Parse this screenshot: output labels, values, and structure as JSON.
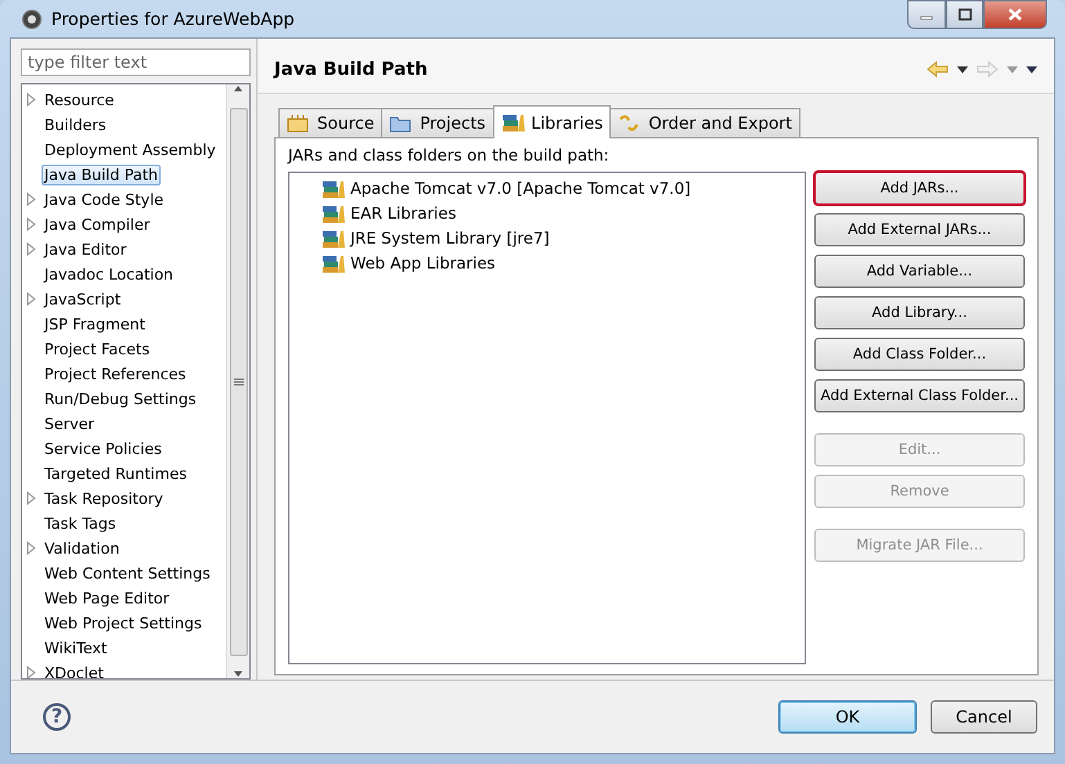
{
  "window": {
    "title": "Properties for AzureWebApp"
  },
  "filter": {
    "placeholder": "type filter text"
  },
  "tree": [
    {
      "label": "Resource",
      "expandable": true,
      "selected": false
    },
    {
      "label": "Builders",
      "expandable": false,
      "selected": false
    },
    {
      "label": "Deployment Assembly",
      "expandable": false,
      "selected": false
    },
    {
      "label": "Java Build Path",
      "expandable": false,
      "selected": true
    },
    {
      "label": "Java Code Style",
      "expandable": true,
      "selected": false
    },
    {
      "label": "Java Compiler",
      "expandable": true,
      "selected": false
    },
    {
      "label": "Java Editor",
      "expandable": true,
      "selected": false
    },
    {
      "label": "Javadoc Location",
      "expandable": false,
      "selected": false
    },
    {
      "label": "JavaScript",
      "expandable": true,
      "selected": false
    },
    {
      "label": "JSP Fragment",
      "expandable": false,
      "selected": false
    },
    {
      "label": "Project Facets",
      "expandable": false,
      "selected": false
    },
    {
      "label": "Project References",
      "expandable": false,
      "selected": false
    },
    {
      "label": "Run/Debug Settings",
      "expandable": false,
      "selected": false
    },
    {
      "label": "Server",
      "expandable": false,
      "selected": false
    },
    {
      "label": "Service Policies",
      "expandable": false,
      "selected": false
    },
    {
      "label": "Targeted Runtimes",
      "expandable": false,
      "selected": false
    },
    {
      "label": "Task Repository",
      "expandable": true,
      "selected": false
    },
    {
      "label": "Task Tags",
      "expandable": false,
      "selected": false
    },
    {
      "label": "Validation",
      "expandable": true,
      "selected": false
    },
    {
      "label": "Web Content Settings",
      "expandable": false,
      "selected": false
    },
    {
      "label": "Web Page Editor",
      "expandable": false,
      "selected": false
    },
    {
      "label": "Web Project Settings",
      "expandable": false,
      "selected": false
    },
    {
      "label": "WikiText",
      "expandable": false,
      "selected": false
    },
    {
      "label": "XDoclet",
      "expandable": true,
      "selected": false
    }
  ],
  "page": {
    "title": "Java Build Path",
    "tabs": [
      {
        "label": "Source",
        "selected": false
      },
      {
        "label": "Projects",
        "selected": false
      },
      {
        "label": "Libraries",
        "selected": true
      },
      {
        "label": "Order and Export",
        "selected": false
      }
    ],
    "list_label": "JARs and class folders on the build path:",
    "libraries": [
      "Apache Tomcat v7.0 [Apache Tomcat v7.0]",
      "EAR Libraries",
      "JRE System Library [jre7]",
      "Web App Libraries"
    ],
    "button_groups": [
      {
        "buttons": [
          {
            "label": "Add JARs...",
            "disabled": false,
            "highlighted": true
          },
          {
            "label": "Add External JARs...",
            "disabled": false,
            "highlighted": false
          },
          {
            "label": "Add Variable...",
            "disabled": false,
            "highlighted": false
          },
          {
            "label": "Add Library...",
            "disabled": false,
            "highlighted": false
          },
          {
            "label": "Add Class Folder...",
            "disabled": false,
            "highlighted": false
          },
          {
            "label": "Add External Class Folder...",
            "disabled": false,
            "highlighted": false
          }
        ]
      },
      {
        "buttons": [
          {
            "label": "Edit...",
            "disabled": true,
            "highlighted": false
          },
          {
            "label": "Remove",
            "disabled": true,
            "highlighted": false
          }
        ]
      },
      {
        "buttons": [
          {
            "label": "Migrate JAR File...",
            "disabled": true,
            "highlighted": false
          }
        ]
      }
    ]
  },
  "footer": {
    "help": "?",
    "buttons": [
      {
        "label": "OK",
        "default": true
      },
      {
        "label": "Cancel",
        "default": false
      }
    ]
  }
}
